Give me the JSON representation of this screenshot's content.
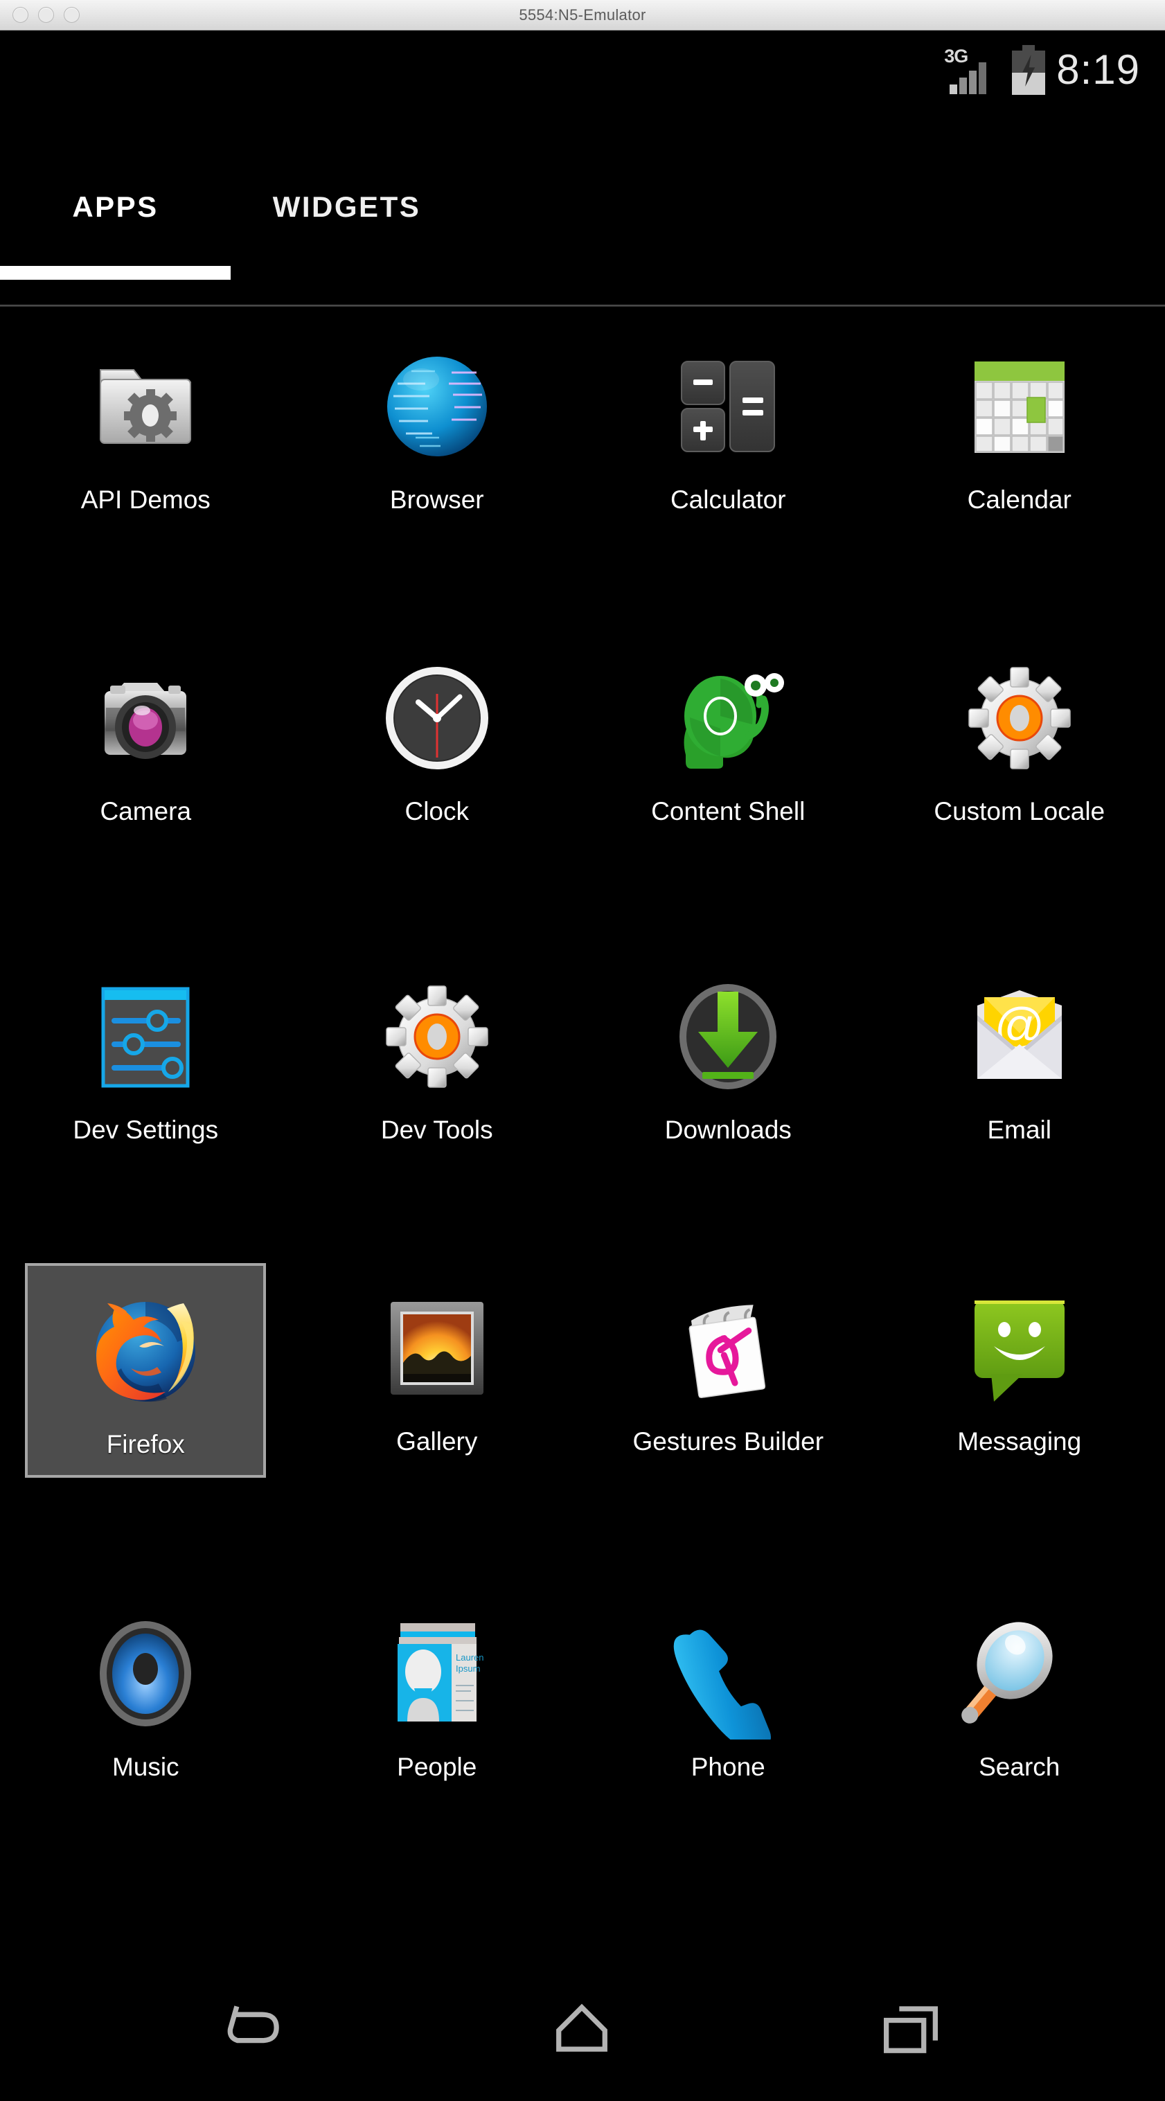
{
  "window": {
    "title": "5554:N5-Emulator",
    "controls": [
      "close",
      "minimize",
      "zoom"
    ]
  },
  "status_bar": {
    "network": "3G",
    "signal_bars": 4,
    "battery_charging": true,
    "battery_level_pct": 50,
    "time": "8:19"
  },
  "tabs": [
    {
      "id": "apps",
      "label": "APPS",
      "selected": true
    },
    {
      "id": "widgets",
      "label": "WIDGETS",
      "selected": false
    }
  ],
  "app_grid": {
    "columns": 4,
    "rows": 5,
    "selected_app": "Firefox",
    "apps": [
      {
        "name": "API Demos",
        "icon": "folder-gear-icon",
        "selected": false
      },
      {
        "name": "Browser",
        "icon": "globe-icon",
        "selected": false
      },
      {
        "name": "Calculator",
        "icon": "calculator-keys-icon",
        "selected": false
      },
      {
        "name": "Calendar",
        "icon": "calendar-grid-icon",
        "selected": false
      },
      {
        "name": "Camera",
        "icon": "camera-icon",
        "selected": false
      },
      {
        "name": "Clock",
        "icon": "analog-clock-icon",
        "selected": false
      },
      {
        "name": "Content Shell",
        "icon": "green-snail-icon",
        "selected": false
      },
      {
        "name": "Custom Locale",
        "icon": "gear-orange-icon",
        "selected": false
      },
      {
        "name": "Dev Settings",
        "icon": "sliders-panel-icon",
        "selected": false
      },
      {
        "name": "Dev Tools",
        "icon": "gear-orange-icon",
        "selected": false
      },
      {
        "name": "Downloads",
        "icon": "download-arrow-icon",
        "selected": false
      },
      {
        "name": "Email",
        "icon": "envelope-at-icon",
        "selected": false
      },
      {
        "name": "Firefox",
        "icon": "firefox-icon",
        "selected": true
      },
      {
        "name": "Gallery",
        "icon": "picture-frame-icon",
        "selected": false
      },
      {
        "name": "Gestures Builder",
        "icon": "notepad-gesture-icon",
        "selected": false
      },
      {
        "name": "Messaging",
        "icon": "speech-bubble-smiley-icon",
        "selected": false
      },
      {
        "name": "Music",
        "icon": "speaker-icon",
        "selected": false
      },
      {
        "name": "People",
        "icon": "contact-card-icon",
        "selected": false
      },
      {
        "name": "Phone",
        "icon": "phone-handset-icon",
        "selected": false
      },
      {
        "name": "Search",
        "icon": "magnifier-icon",
        "selected": false
      }
    ]
  },
  "people_card_text": {
    "line1": "Lauren",
    "line2": "Ipsum"
  },
  "nav_bar": [
    {
      "id": "back",
      "icon": "back-arrow-icon"
    },
    {
      "id": "home",
      "icon": "home-icon"
    },
    {
      "id": "recent",
      "icon": "recent-apps-icon"
    }
  ],
  "colors": {
    "screen_bg": "#000000",
    "titlebar_bg": "#e8e8e8",
    "selection_bg": "#4d4d4d",
    "selection_border": "#a6a6a6",
    "tab_active": "#ffffff",
    "nav_icon": "#b3b3b3",
    "android_green": "#8bc34a",
    "firefox_orange": "#ff7139"
  }
}
